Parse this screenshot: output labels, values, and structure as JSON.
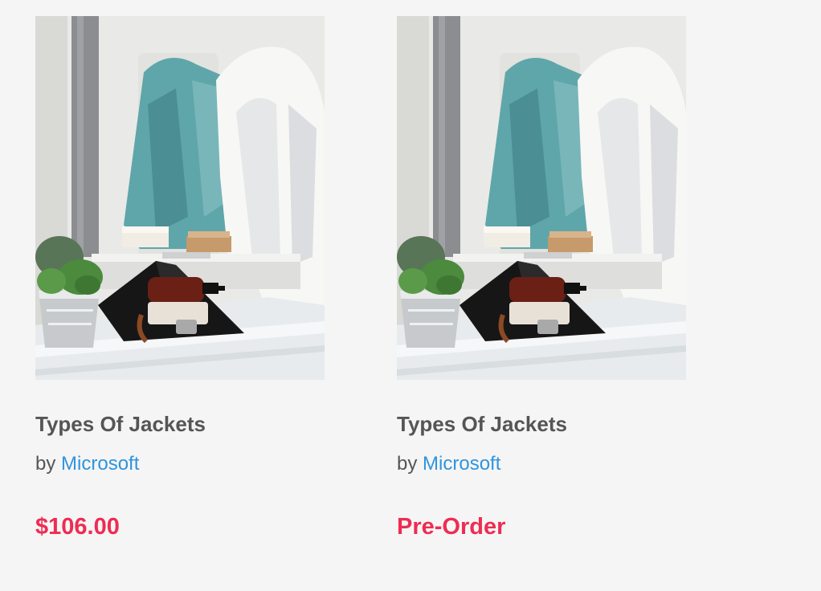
{
  "colors": {
    "page_background": "#f5f5f5",
    "title_text": "#555555",
    "vendor_link": "#2f94dd",
    "price_accent": "#ee2c52"
  },
  "products": [
    {
      "image_alt": "product-photo-jackets-on-chair",
      "title": "Types Of Jackets",
      "vendor_prefix": "by",
      "vendor": "Microsoft",
      "price": "$106.00"
    },
    {
      "image_alt": "product-photo-jackets-on-chair",
      "title": "Types Of Jackets",
      "vendor_prefix": "by",
      "vendor": "Microsoft",
      "price": "Pre-Order"
    }
  ]
}
